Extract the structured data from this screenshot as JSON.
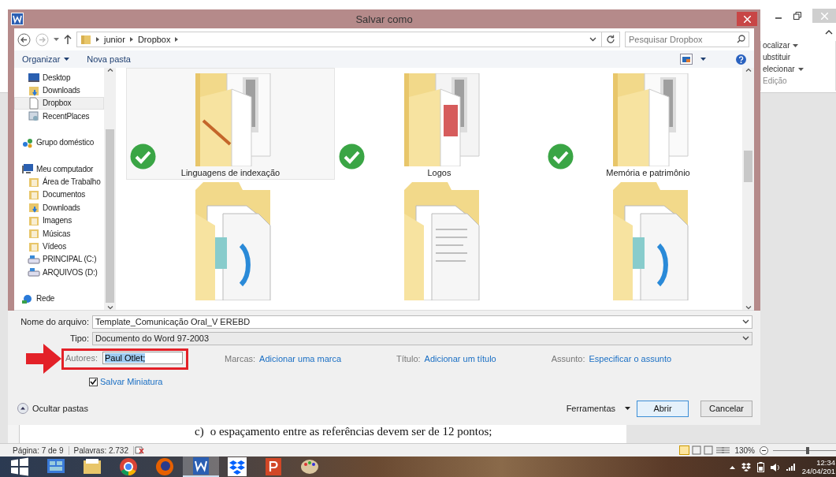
{
  "dialog": {
    "title": "Salvar como",
    "breadcrumb": [
      "junior",
      "Dropbox"
    ],
    "search": {
      "placeholder": "Pesquisar Dropbox"
    },
    "toolbar": [
      "Organizar",
      "Nova pasta"
    ],
    "sidebar": {
      "items": [
        {
          "label": "Desktop",
          "kind": "favorite",
          "selected": false
        },
        {
          "label": "Downloads",
          "kind": "favorite",
          "selected": false
        },
        {
          "label": "Dropbox",
          "kind": "favorite",
          "selected": true
        },
        {
          "label": "RecentPlaces",
          "kind": "favorite",
          "selected": false
        },
        {
          "label": "Grupo doméstico",
          "kind": "root",
          "selected": false
        },
        {
          "label": "Meu computador",
          "kind": "root",
          "selected": false,
          "children": [
            {
              "label": "Área de Trabalho",
              "selected": false
            },
            {
              "label": "Documentos",
              "selected": false
            },
            {
              "label": "Downloads",
              "selected": false
            },
            {
              "label": "Imagens",
              "selected": false
            },
            {
              "label": "Músicas",
              "selected": false
            },
            {
              "label": "Vídeos",
              "selected": false
            },
            {
              "label": "PRINCIPAL (C:)",
              "selected": false
            },
            {
              "label": "ARQUIVOS (D:)",
              "selected": false
            }
          ]
        },
        {
          "label": "Rede",
          "kind": "root",
          "selected": false
        }
      ]
    },
    "folders": [
      {
        "name": "Linguagens de indexação",
        "synced": true,
        "selected": true
      },
      {
        "name": "Logos",
        "synced": true,
        "selected": false
      },
      {
        "name": "Memória e patrimônio",
        "synced": true,
        "selected": false
      },
      {
        "synced": false,
        "selected": false
      },
      {
        "synced": false,
        "selected": false
      },
      {
        "synced": false,
        "selected": false
      }
    ],
    "file_name": {
      "label": "Nome do arquivo:",
      "value": "Template_Comunicação Oral_V EREBD"
    },
    "file_type": {
      "label": "Tipo:",
      "value": "Documento do Word 97-2003"
    },
    "authors": {
      "label": "Autores:",
      "value": "Paul Otlet;"
    },
    "tags": {
      "label": "Marcas:",
      "link": "Adicionar uma marca"
    },
    "doc_title": {
      "label": "Título:",
      "link": "Adicionar um título"
    },
    "subject": {
      "label": "Assunto:",
      "link": "Especificar o assunto"
    },
    "thumbnail": {
      "label": "Salvar Miniatura",
      "checked": true
    },
    "hide_folders": "Ocultar pastas",
    "tools": "Ferramentas",
    "buttons": [
      "Abrir",
      "Cancelar"
    ]
  },
  "word": {
    "ribbon": [
      {
        "label": "ocalizar",
        "menu": true
      },
      {
        "label": "ubstituir",
        "menu": false
      },
      {
        "label": "elecionar",
        "menu": true
      }
    ],
    "ribbon_group": "Edição",
    "document_line": {
      "marker": "c)",
      "text": "o espaçamento entre as referências devem ser de 12 pontos;"
    },
    "status": [
      "Página: 7 de 9",
      "Palavras: 2.732"
    ],
    "zoom": {
      "label": "130%",
      "level": 0.55
    }
  },
  "taskbar": {
    "apps": [
      {
        "kind": "start",
        "selected": false
      },
      {
        "kind": "control-panel",
        "selected": false
      },
      {
        "kind": "explorer",
        "selected": false
      },
      {
        "kind": "chrome",
        "selected": false
      },
      {
        "kind": "firefox",
        "selected": false
      },
      {
        "kind": "word",
        "selected": true
      },
      {
        "kind": "dropbox",
        "selected": false
      },
      {
        "kind": "powerpoint",
        "selected": false
      },
      {
        "kind": "paint",
        "selected": false
      }
    ],
    "time": "12:34",
    "date": "24/04/201"
  }
}
